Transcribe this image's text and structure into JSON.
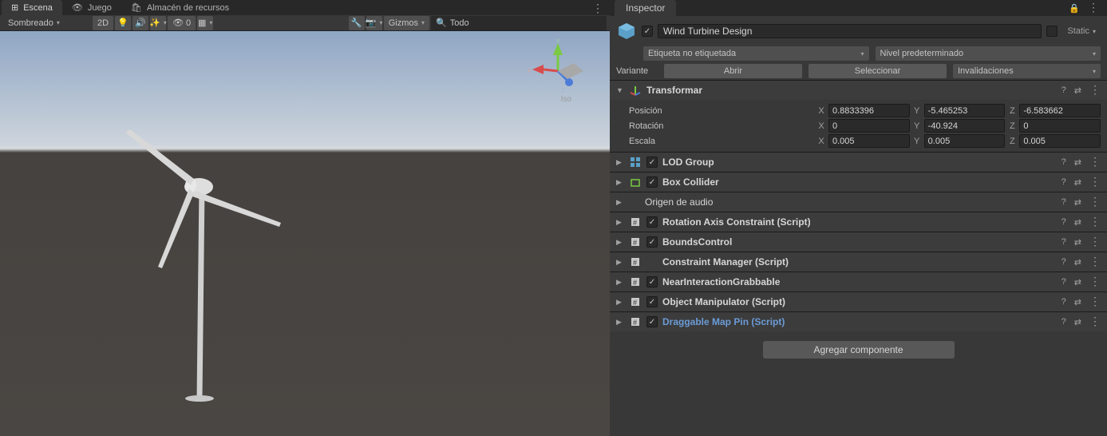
{
  "tabs": {
    "scene": "Escena",
    "game": "Juego",
    "assets": "Almacén de recursos"
  },
  "scene_toolbar": {
    "shaded": "Sombreado",
    "twod": "2D",
    "zero": "0",
    "gizmos": "Gizmos",
    "search": "Todo"
  },
  "viewport": {
    "iso": "Iso",
    "axes": {
      "x": "x",
      "y": "y",
      "z": "z"
    }
  },
  "inspector": {
    "title": "Inspector",
    "object_name": "Wind Turbine Design",
    "static": "Static",
    "tag_label": "Etiqueta",
    "tag_value": "no etiquetada",
    "layer_label": "Nivel",
    "layer_value": "predeterminado",
    "variant_label": "Variante",
    "open": "Abrir",
    "select": "Seleccionar",
    "overrides": "Invalidaciones"
  },
  "transform": {
    "title": "Transformar",
    "position": "Posición",
    "rotation": "Rotación",
    "scale": "Escala",
    "pos": {
      "x": "0.8833396",
      "y": "-5.465253",
      "z": "-6.583662"
    },
    "rot": {
      "x": "0",
      "y": "-40.924",
      "z": "0"
    },
    "scl": {
      "x": "0.005",
      "y": "0.005",
      "z": "0.005"
    }
  },
  "components": {
    "lod": "LOD Group",
    "box": "Box Collider",
    "audio": "Origen de audio",
    "rotaxis": "Rotation Axis Constraint (Script)",
    "bounds": "BoundsControl",
    "constraint": "Constraint Manager (Script)",
    "near": "NearInteractionGrabbable",
    "objman": "Object Manipulator (Script)",
    "dragpin": "Draggable Map Pin (Script)"
  },
  "add_component": "Agregar componente"
}
